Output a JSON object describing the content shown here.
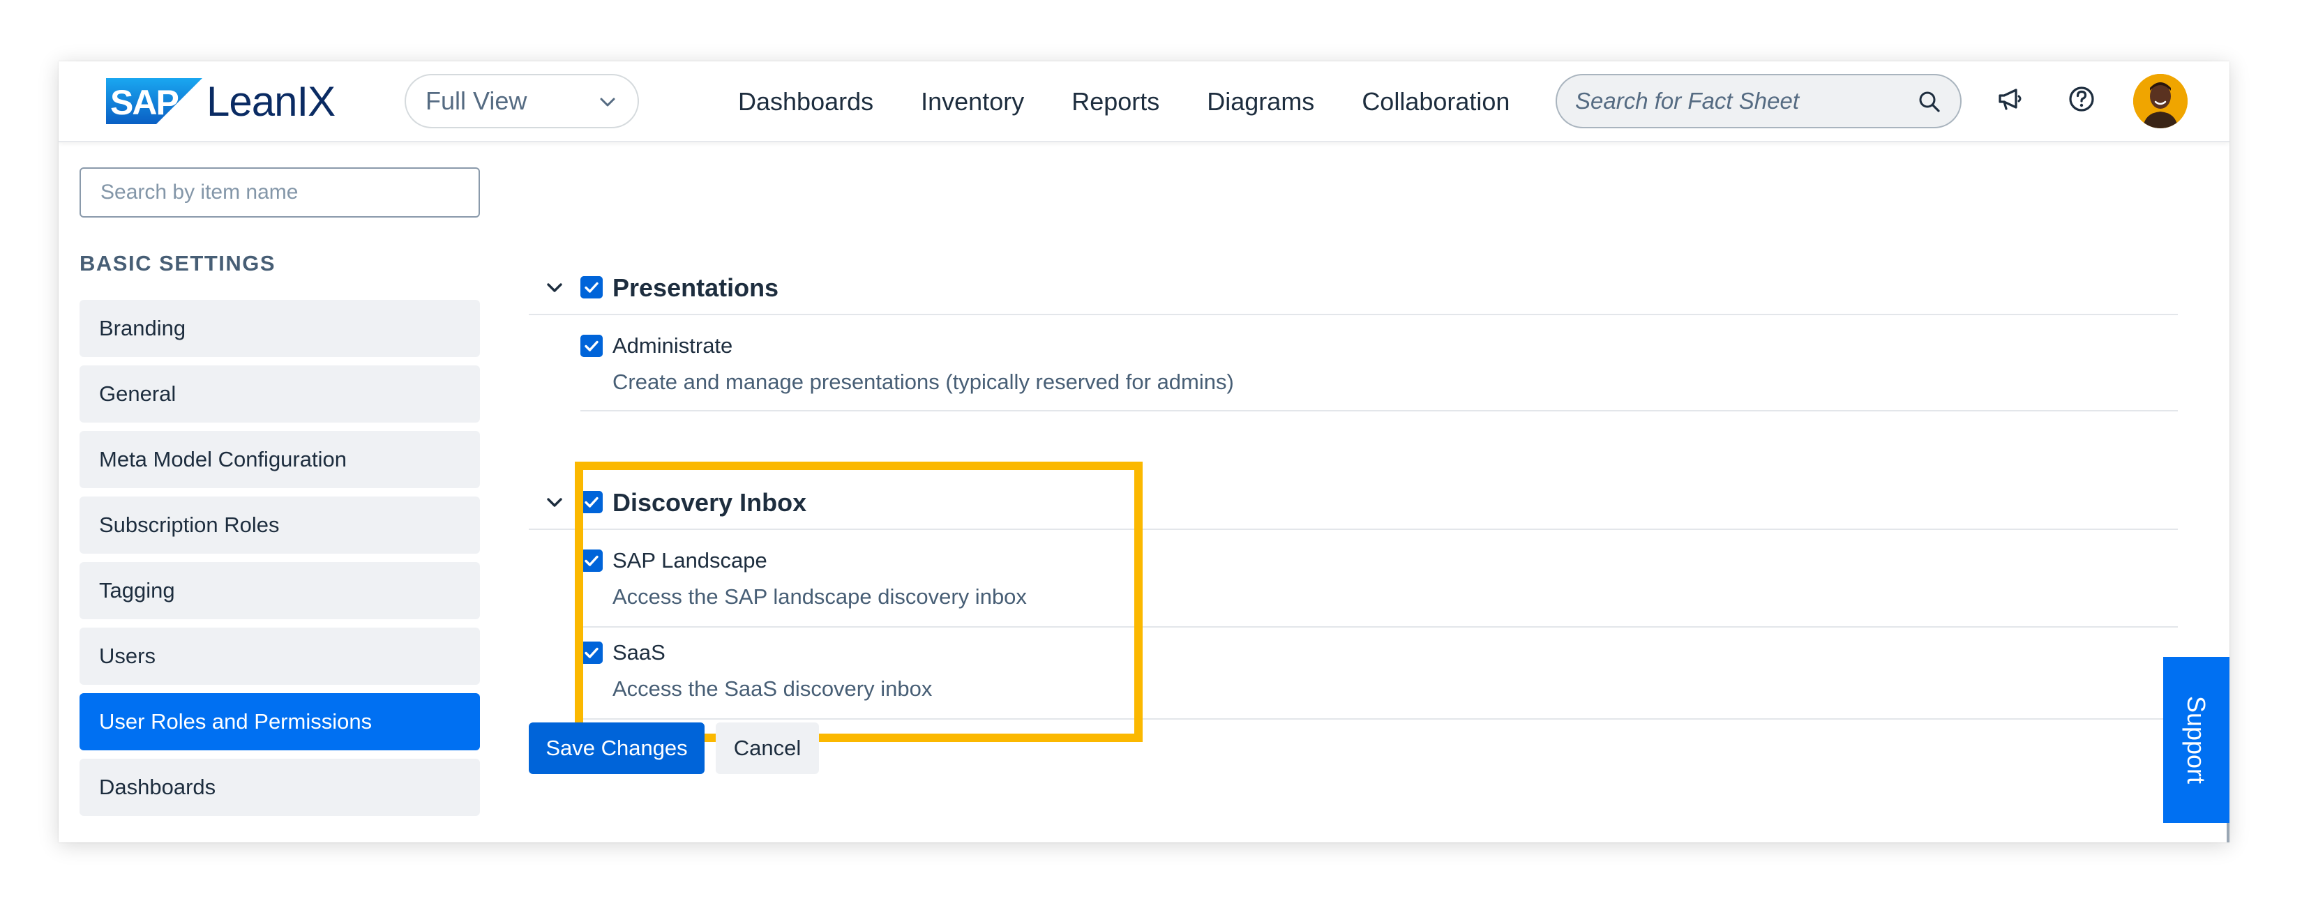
{
  "header": {
    "logo": {
      "brand": "SAP",
      "product": "LeanIX"
    },
    "view_select": {
      "value": "Full View"
    },
    "nav": [
      "Dashboards",
      "Inventory",
      "Reports",
      "Diagrams",
      "Collaboration"
    ],
    "search": {
      "placeholder": "Search for Fact Sheet"
    },
    "icons": [
      "megaphone-icon",
      "help-icon",
      "avatar"
    ]
  },
  "sidebar": {
    "search_placeholder": "Search by item name",
    "section_title": "BASIC SETTINGS",
    "items": [
      {
        "label": "Branding",
        "active": false
      },
      {
        "label": "General",
        "active": false
      },
      {
        "label": "Meta Model Configuration",
        "active": false
      },
      {
        "label": "Subscription Roles",
        "active": false
      },
      {
        "label": "Tagging",
        "active": false
      },
      {
        "label": "Users",
        "active": false
      },
      {
        "label": "User Roles and Permissions",
        "active": true
      },
      {
        "label": "Dashboards",
        "active": false
      }
    ]
  },
  "permissions": {
    "groups": [
      {
        "title": "Presentations",
        "checked": true,
        "items": [
          {
            "label": "Administrate",
            "description": "Create and manage presentations (typically reserved for admins)",
            "checked": true
          }
        ]
      },
      {
        "title": "Discovery Inbox",
        "checked": true,
        "highlighted": true,
        "items": [
          {
            "label": "SAP Landscape",
            "description": "Access the SAP landscape discovery inbox",
            "checked": true
          },
          {
            "label": "SaaS",
            "description": "Access the SaaS discovery inbox",
            "checked": true
          }
        ]
      }
    ]
  },
  "actions": {
    "save_label": "Save Changes",
    "cancel_label": "Cancel"
  },
  "support_label": "Support",
  "colors": {
    "accent": "#0064d9",
    "active_nav": "#0070f2",
    "highlight": "#fbb800",
    "brand_navy": "#0a2b63"
  }
}
